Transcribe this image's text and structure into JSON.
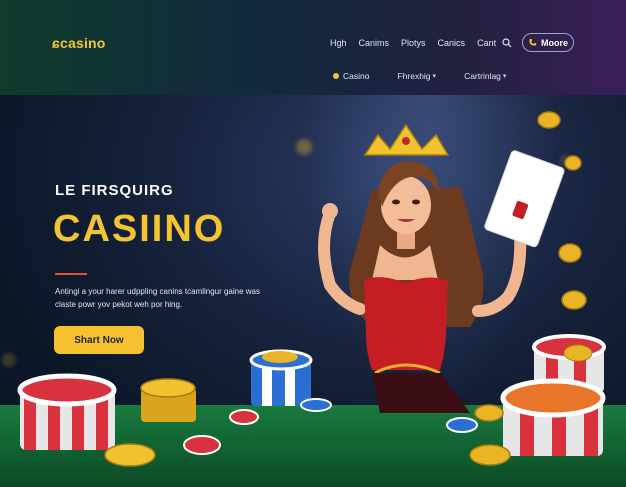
{
  "header": {
    "logo": "ɕcasino",
    "nav": [
      "Hgh",
      "Canims",
      "Plotys",
      "Canics",
      "Cant"
    ],
    "more_label": "Moore",
    "sub_nav": [
      {
        "label": "Casino",
        "icon": "dot-icon"
      },
      {
        "label": "Fhrexhig",
        "icon": "chevron-down-icon"
      },
      {
        "label": "Cartrinlag",
        "icon": "chevron-down-icon"
      }
    ]
  },
  "hero": {
    "kicker": "LE FIRSQUIRG",
    "title": "CASIINO",
    "description": "Antingi a your harer udppling canins tcamlingur gaine was claste powr yov pekot weh por hing.",
    "cta_label": "Shart Now"
  },
  "colors": {
    "accent": "#f5c531",
    "button": "#f6c12f",
    "table_green": "#1a7a3f",
    "chip_red": "#d7323d",
    "dress_red": "#c41e24"
  }
}
